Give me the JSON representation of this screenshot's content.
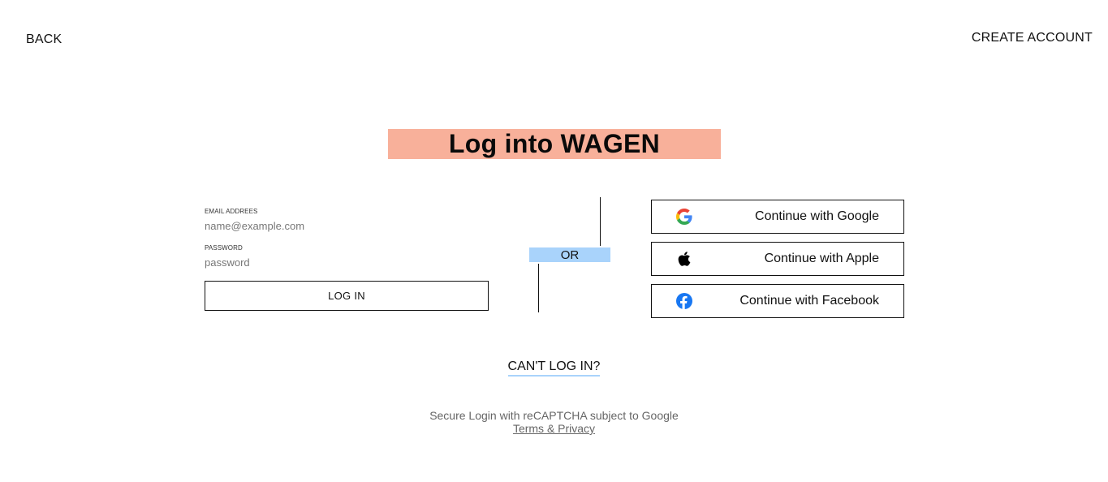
{
  "nav": {
    "back_label": "BACK",
    "create_account_label": "CREATE ACCOUNT"
  },
  "title": "Log into WAGEN",
  "form": {
    "email_label": "EMAIL ADDREES",
    "email_placeholder": "name@example.com",
    "email_value": "",
    "password_label": "PASSWORD",
    "password_placeholder": "password",
    "password_value": "",
    "login_button_label": "LOG IN"
  },
  "divider": {
    "or_label": "OR"
  },
  "social": {
    "google_label": "Continue with Google",
    "apple_label": "Continue with Apple",
    "facebook_label": "Continue with Facebook",
    "icons": [
      "google-icon",
      "apple-icon",
      "facebook-icon"
    ]
  },
  "help": {
    "cant_login_label": "CAN'T LOG IN?"
  },
  "footer": {
    "recaptcha_text": "Secure Login with reCAPTCHA subject to Google",
    "terms_label": "Terms & Privacy"
  },
  "colors": {
    "title_bg": "#f8b09a",
    "or_bg": "#a9d3fb",
    "underline_accent": "#a9d3fb",
    "facebook_blue": "#1877f2"
  }
}
